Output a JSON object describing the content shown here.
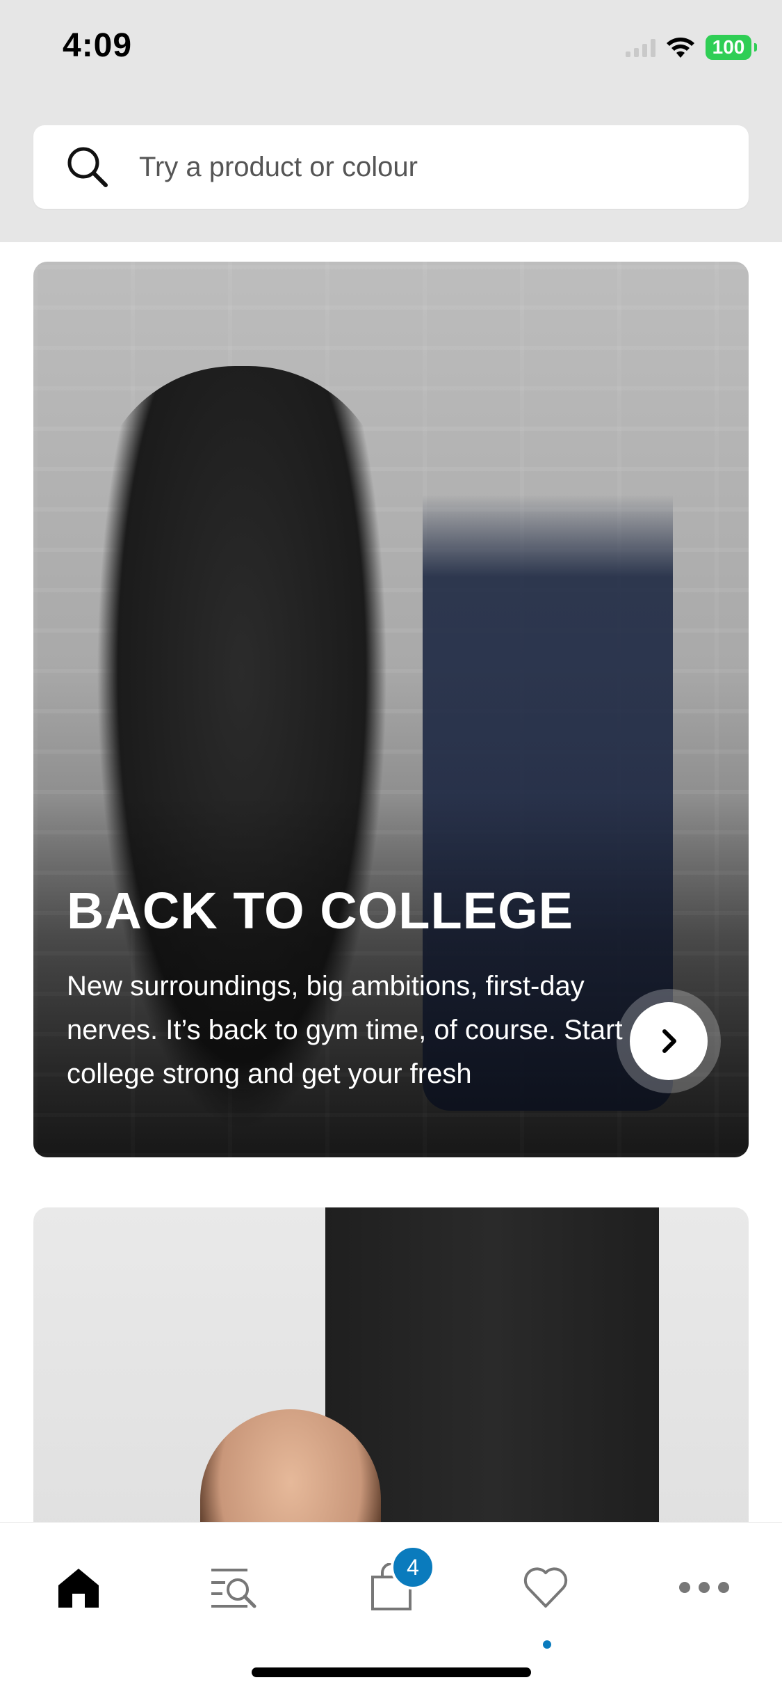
{
  "status_bar": {
    "time": "4:09",
    "battery": "100",
    "battery_color": "#2fce55"
  },
  "search": {
    "placeholder": "Try a product or colour",
    "icon": "search-icon"
  },
  "hero": {
    "title": "BACK TO COLLEGE",
    "body": "New surroundings, big ambitions, first-day nerves. It’s back to gym time, of course. Start college strong and get your fresh",
    "cta_icon": "chevron-right-icon"
  },
  "card2": {
    "image": "model-in-black-leggings"
  },
  "tabbar": {
    "items": [
      {
        "icon": "home-icon",
        "active": true
      },
      {
        "icon": "search-list-icon",
        "active": false
      },
      {
        "icon": "bag-icon",
        "active": false,
        "badge": "4"
      },
      {
        "icon": "heart-icon",
        "active": false,
        "indicator": true
      },
      {
        "icon": "more-icon",
        "active": false
      }
    ],
    "accent": "#0a7bbd"
  }
}
